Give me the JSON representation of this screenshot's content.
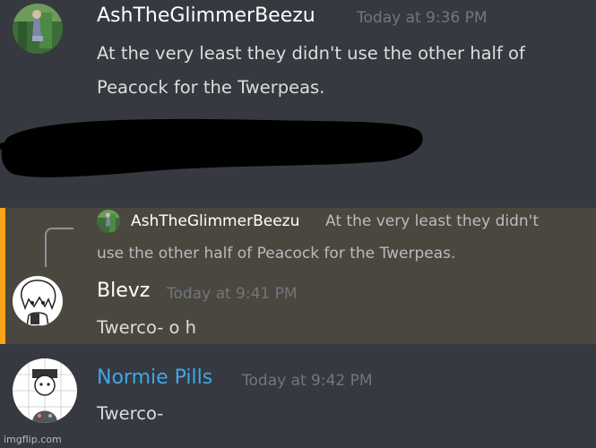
{
  "messages": [
    {
      "author": "AshTheGlimmerBeezu",
      "timestamp": "Today at 9:36 PM",
      "lines": [
        "At the very least they didn't use the other half of",
        "Peacock for the Twerpeas."
      ],
      "name_color": "#ffffff"
    },
    {
      "author": "Blevz",
      "timestamp": "Today at 9:41 PM",
      "lines": [
        "Twerco- o h"
      ],
      "name_color": "#ffffff",
      "reply": {
        "author": "AshTheGlimmerBeezu",
        "text_line1": "At the very least they didn't",
        "text_line2": "use the other half of Peacock for the Twerpeas."
      },
      "highlight_color": "#faa61a"
    },
    {
      "author": "Normie Pills",
      "timestamp": "Today at 9:42 PM",
      "lines": [
        "Twerco-"
      ],
      "name_color": "#3ea8e6"
    }
  ],
  "watermark": "imgflip.com",
  "icons": {
    "avatar_ash": "ash-avatar-icon",
    "avatar_blevz": "blevz-avatar-icon",
    "avatar_normie": "normie-avatar-icon"
  }
}
